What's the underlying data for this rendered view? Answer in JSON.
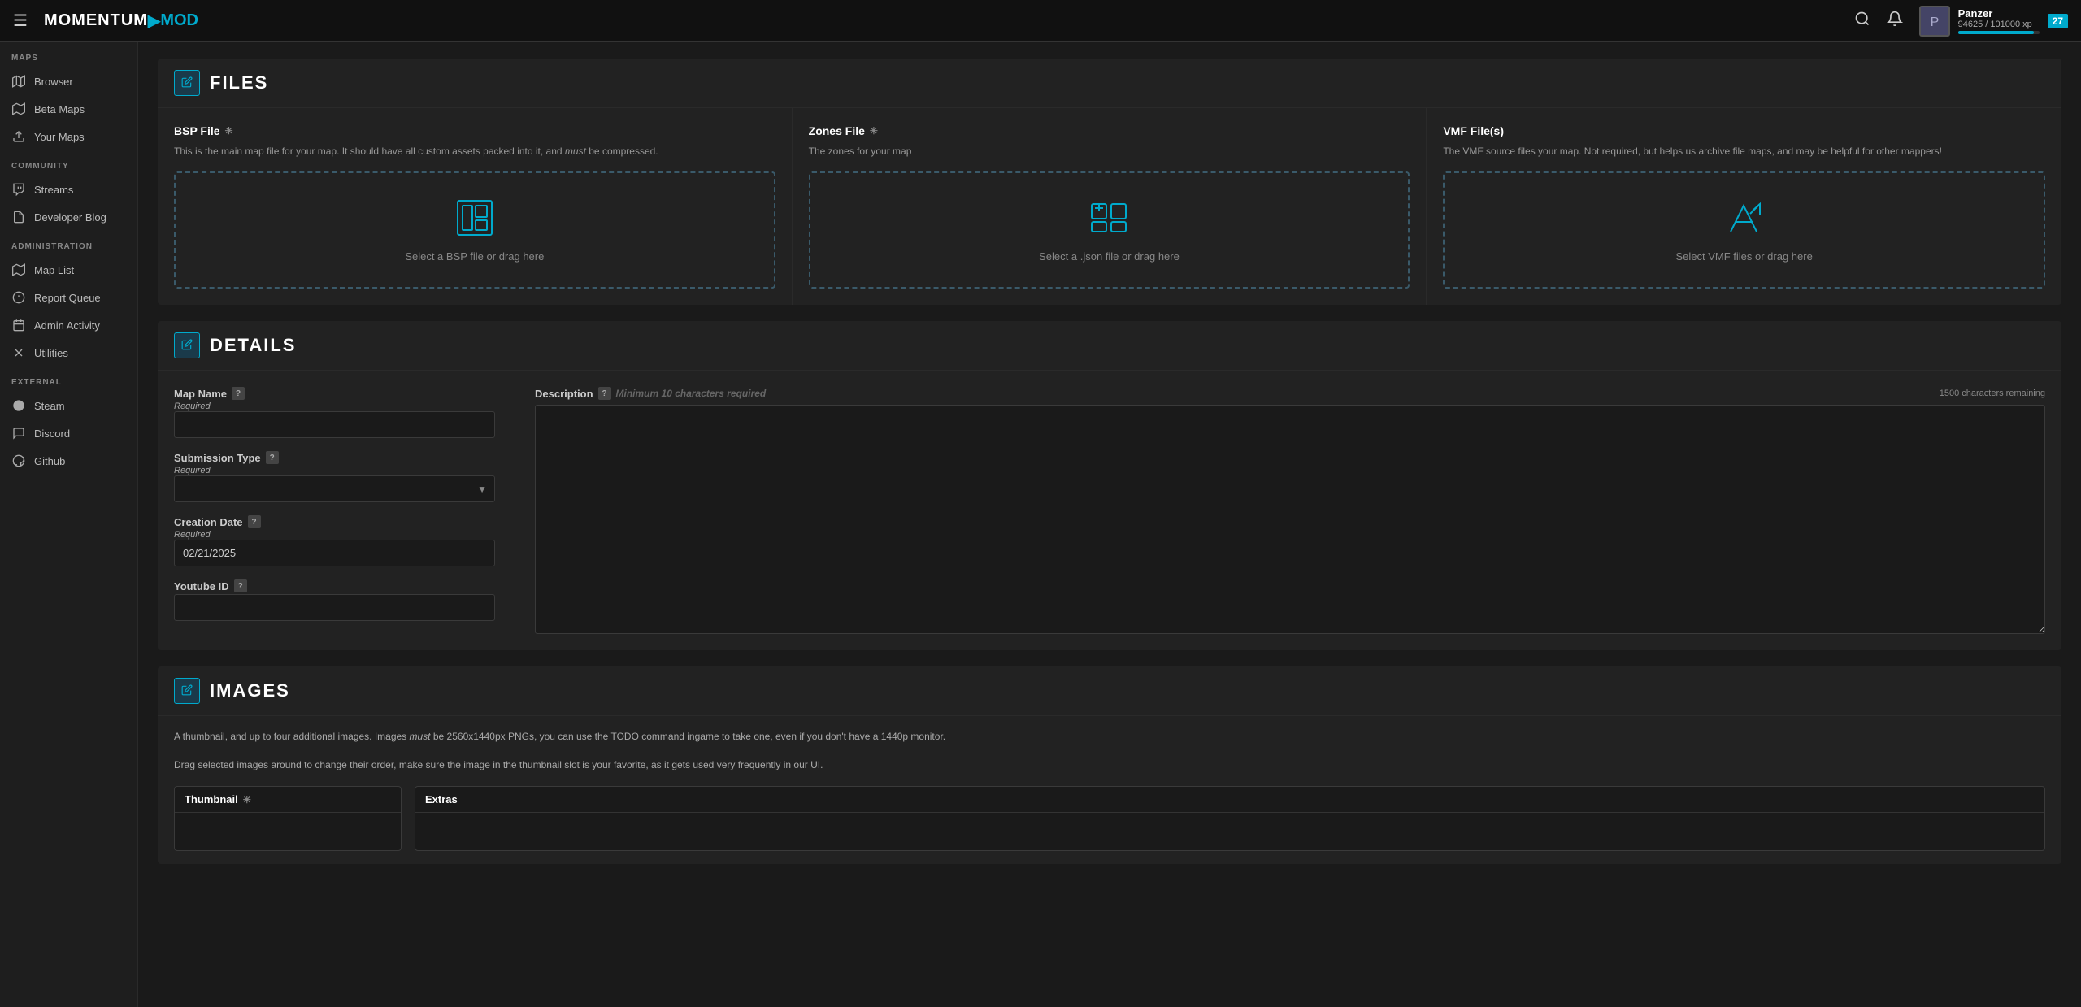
{
  "topnav": {
    "hamburger_label": "☰",
    "logo_momentum": "MOMENTUM",
    "logo_arrow": "▶",
    "logo_mod": "MOD",
    "search_icon": "🔍",
    "bell_icon": "🔔",
    "user": {
      "name": "Panzer",
      "xp_current": "94625",
      "xp_max": "101000",
      "xp_unit": "xp",
      "level": "27",
      "avatar_emoji": "🎮"
    }
  },
  "sidebar": {
    "maps_label": "MAPS",
    "maps_items": [
      {
        "id": "browser",
        "label": "Browser",
        "icon": "🗺"
      },
      {
        "id": "beta-maps",
        "label": "Beta Maps",
        "icon": "🗺"
      },
      {
        "id": "your-maps",
        "label": "Your Maps",
        "icon": "⬆"
      }
    ],
    "community_label": "COMMUNITY",
    "community_items": [
      {
        "id": "streams",
        "label": "Streams",
        "icon": "📺"
      },
      {
        "id": "developer-blog",
        "label": "Developer Blog",
        "icon": "📄"
      }
    ],
    "admin_label": "ADMINISTRATION",
    "admin_items": [
      {
        "id": "map-list",
        "label": "Map List",
        "icon": "🗺"
      },
      {
        "id": "report-queue",
        "label": "Report Queue",
        "icon": "⚙"
      },
      {
        "id": "admin-activity",
        "label": "Admin Activity",
        "icon": "📋"
      },
      {
        "id": "utilities",
        "label": "Utilities",
        "icon": "✖"
      }
    ],
    "external_label": "EXTERNAL",
    "external_items": [
      {
        "id": "steam",
        "label": "Steam",
        "icon": "🎮"
      },
      {
        "id": "discord",
        "label": "Discord",
        "icon": "💬"
      },
      {
        "id": "github",
        "label": "Github",
        "icon": "⚫"
      }
    ]
  },
  "files_section": {
    "title": "FILES",
    "bsp": {
      "label": "BSP File",
      "asterisk": "✳",
      "desc": "This is the main map file for your map. It should have all custom assets packed into it, and must be compressed.",
      "dropzone_text": "Select a BSP file or drag here"
    },
    "zones": {
      "label": "Zones File",
      "asterisk": "✳",
      "desc": "The zones for your map",
      "dropzone_text": "Select a .json file or drag here"
    },
    "vmf": {
      "label": "VMF File(s)",
      "desc": "The VMF source files your map. Not required, but helps us archive file maps, and may be helpful for other mappers!",
      "dropzone_text": "Select VMF files or drag here"
    }
  },
  "details_section": {
    "title": "DETAILS",
    "map_name_label": "Map Name",
    "map_name_required": "Required",
    "map_name_value": "",
    "submission_type_label": "Submission Type",
    "submission_type_required": "Required",
    "submission_type_value": "",
    "creation_date_label": "Creation Date",
    "creation_date_required": "Required",
    "creation_date_value": "02/21/2025",
    "youtube_id_label": "Youtube ID",
    "youtube_id_value": "",
    "description_label": "Description",
    "description_placeholder": "Minimum 10 characters required",
    "description_char_count": "1500 characters remaining",
    "description_value": ""
  },
  "images_section": {
    "title": "IMAGES",
    "desc_line1": "A thumbnail, and up to four additional images. Images must be 2560x1440px PNGs, you can use the TODO command ingame to take one, even if you don't have a 1440p monitor.",
    "desc_line2": "Drag selected images around to change their order, make sure the image in the thumbnail slot is your favorite, as it gets used very frequently in our UI.",
    "thumbnail_label": "Thumbnail",
    "thumbnail_asterisk": "✳",
    "extras_label": "Extras"
  }
}
